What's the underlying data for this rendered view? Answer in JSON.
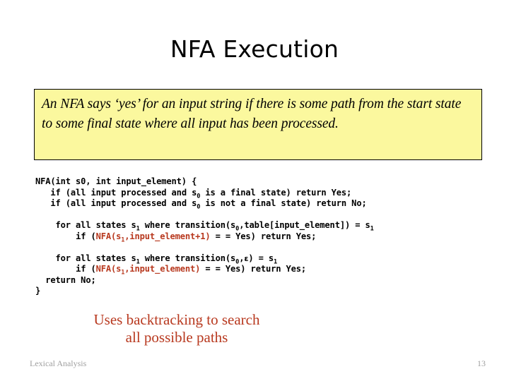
{
  "slide": {
    "title": "NFA Execution",
    "callout": {
      "text": "An NFA says ‘yes’ for an input string if there is some path from the start state to some final state where all input has been processed.",
      "background_color": "#FBF89E",
      "border_color": "#000000"
    },
    "code": {
      "accent_color": "#B8391F",
      "lines": [
        {
          "id": "signature",
          "indent": 0,
          "segments": [
            {
              "text": "NFA(int s0, int input_element) {",
              "style": "plain"
            }
          ]
        },
        {
          "id": "if-final-yes",
          "indent": 3,
          "segments": [
            {
              "text": "if (all input processed and s",
              "style": "plain"
            },
            {
              "text": "0",
              "style": "sub"
            },
            {
              "text": " is a final state) return Yes;",
              "style": "plain"
            }
          ]
        },
        {
          "id": "if-not-final-no",
          "indent": 3,
          "segments": [
            {
              "text": "if (all input processed and s",
              "style": "plain"
            },
            {
              "text": "0",
              "style": "sub"
            },
            {
              "text": " is not a final state) return No;",
              "style": "plain"
            }
          ]
        },
        {
          "id": "blank-1",
          "indent": 0,
          "blank": true,
          "segments": []
        },
        {
          "id": "for-transition-table",
          "indent": 4,
          "segments": [
            {
              "text": "for all states s",
              "style": "plain"
            },
            {
              "text": "1",
              "style": "sub"
            },
            {
              "text": " where transition(s",
              "style": "plain"
            },
            {
              "text": "0",
              "style": "sub"
            },
            {
              "text": ",table[input_element]) = s",
              "style": "plain"
            },
            {
              "text": "1",
              "style": "sub"
            }
          ]
        },
        {
          "id": "if-recurse-advance",
          "indent": 8,
          "segments": [
            {
              "text": "if (",
              "style": "plain"
            },
            {
              "text": "NFA(s",
              "style": "accent"
            },
            {
              "text": "1",
              "style": "accent-sub"
            },
            {
              "text": ",input_element+1)",
              "style": "accent"
            },
            {
              "text": " = = Yes) return Yes;",
              "style": "plain"
            }
          ]
        },
        {
          "id": "blank-2",
          "indent": 0,
          "blank": true,
          "segments": []
        },
        {
          "id": "for-transition-epsilon",
          "indent": 4,
          "segments": [
            {
              "text": "for all states s",
              "style": "plain"
            },
            {
              "text": "1",
              "style": "sub"
            },
            {
              "text": " where transition(s",
              "style": "plain"
            },
            {
              "text": "0",
              "style": "sub"
            },
            {
              "text": ",",
              "style": "plain"
            },
            {
              "text": "ε",
              "style": "epsilon"
            },
            {
              "text": ") = s",
              "style": "plain"
            },
            {
              "text": "1",
              "style": "sub"
            }
          ]
        },
        {
          "id": "if-recurse-same",
          "indent": 8,
          "segments": [
            {
              "text": "if (",
              "style": "plain"
            },
            {
              "text": "NFA(s",
              "style": "accent"
            },
            {
              "text": "1",
              "style": "accent-sub"
            },
            {
              "text": ",input_element)",
              "style": "accent"
            },
            {
              "text": " = = Yes) return Yes;",
              "style": "plain"
            }
          ]
        },
        {
          "id": "return-no",
          "indent": 2,
          "segments": [
            {
              "text": "return No;",
              "style": "plain"
            }
          ]
        },
        {
          "id": "close-brace",
          "indent": 0,
          "segments": [
            {
              "text": "}",
              "style": "plain"
            }
          ]
        }
      ]
    },
    "caption": {
      "line1": "Uses backtracking to search",
      "line2": "all possible paths",
      "color": "#B8391F"
    },
    "footer": {
      "left": "Lexical Analysis",
      "page": "13",
      "color": "#A0A0A0"
    }
  }
}
